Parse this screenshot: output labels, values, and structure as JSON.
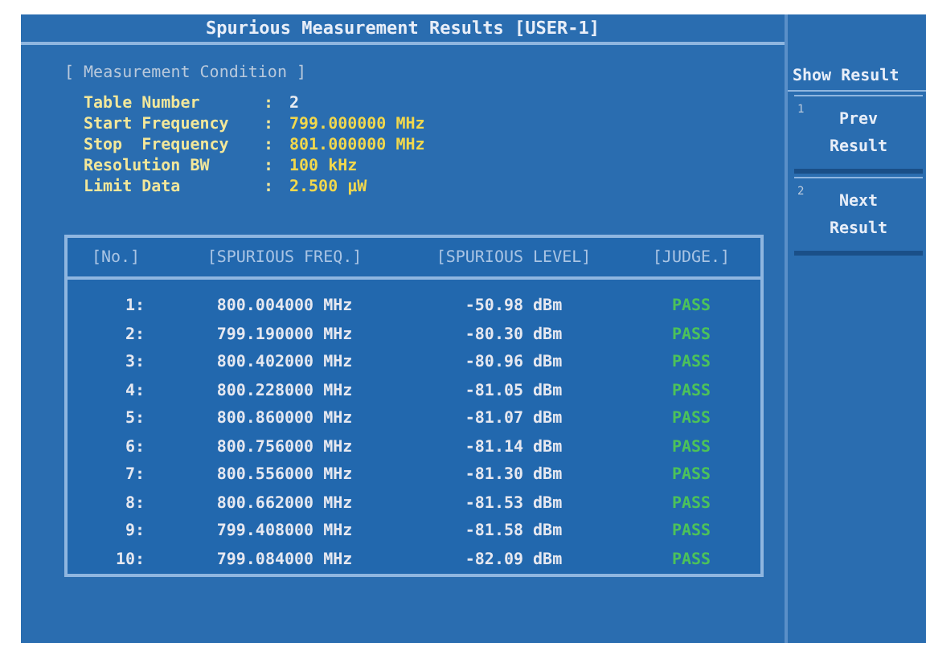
{
  "title": "Spurious Measurement Results [USER-1]",
  "condition": {
    "heading": "[ Measurement Condition ]",
    "rows": [
      {
        "label": "Table Number",
        "sep": ":",
        "value": "2",
        "kind": "plain"
      },
      {
        "label": "Start Frequency",
        "sep": ":",
        "value": "799.000000 MHz",
        "kind": "highlight"
      },
      {
        "label": "Stop  Frequency",
        "sep": ":",
        "value": "801.000000 MHz",
        "kind": "highlight"
      },
      {
        "label": "Resolution BW",
        "sep": ":",
        "value": "100 kHz",
        "kind": "highlight"
      },
      {
        "label": "Limit Data",
        "sep": ":",
        "value": "2.500 µW",
        "kind": "highlight"
      }
    ]
  },
  "table": {
    "columns": [
      "[No.]",
      "[SPURIOUS FREQ.]",
      "[SPURIOUS LEVEL]",
      "[JUDGE.]"
    ],
    "rows": [
      {
        "no": "1:",
        "freq": "800.004000 MHz",
        "level": "-50.98 dBm",
        "judge": "PASS",
        "pass": true
      },
      {
        "no": "2:",
        "freq": "799.190000 MHz",
        "level": "-80.30 dBm",
        "judge": "PASS",
        "pass": true
      },
      {
        "no": "3:",
        "freq": "800.402000 MHz",
        "level": "-80.96 dBm",
        "judge": "PASS",
        "pass": true
      },
      {
        "no": "4:",
        "freq": "800.228000 MHz",
        "level": "-81.05 dBm",
        "judge": "PASS",
        "pass": true
      },
      {
        "no": "5:",
        "freq": "800.860000 MHz",
        "level": "-81.07 dBm",
        "judge": "PASS",
        "pass": true
      },
      {
        "no": "6:",
        "freq": "800.756000 MHz",
        "level": "-81.14 dBm",
        "judge": "PASS",
        "pass": true
      },
      {
        "no": "7:",
        "freq": "800.556000 MHz",
        "level": "-81.30 dBm",
        "judge": "PASS",
        "pass": true
      },
      {
        "no": "8:",
        "freq": "800.662000 MHz",
        "level": "-81.53 dBm",
        "judge": "PASS",
        "pass": true
      },
      {
        "no": "9:",
        "freq": "799.408000 MHz",
        "level": "-81.58 dBm",
        "judge": "PASS",
        "pass": true
      },
      {
        "no": "10:",
        "freq": "799.084000 MHz",
        "level": "-82.09 dBm",
        "judge": "PASS",
        "pass": true
      }
    ]
  },
  "side_menu": {
    "title": "Show Result",
    "buttons": [
      {
        "key": "1",
        "label": "Prev\nResult"
      },
      {
        "key": "2",
        "label": "Next\nResult"
      }
    ]
  }
}
